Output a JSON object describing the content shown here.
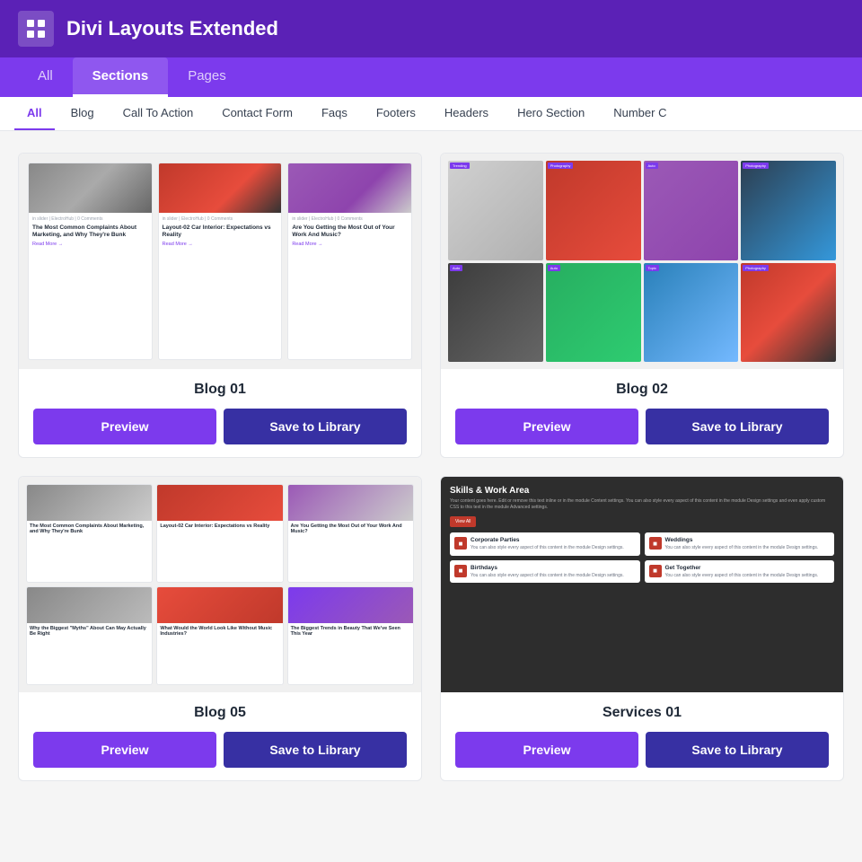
{
  "header": {
    "title": "Divi Layouts Extended",
    "icon_label": "grid-icon"
  },
  "nav": {
    "tabs": [
      {
        "id": "all",
        "label": "All",
        "active": false
      },
      {
        "id": "sections",
        "label": "Sections",
        "active": true
      },
      {
        "id": "pages",
        "label": "Pages",
        "active": false
      }
    ]
  },
  "filters": {
    "items": [
      {
        "id": "all",
        "label": "All",
        "active": true
      },
      {
        "id": "blog",
        "label": "Blog",
        "active": false
      },
      {
        "id": "cta",
        "label": "Call To Action",
        "active": false
      },
      {
        "id": "contact",
        "label": "Contact Form",
        "active": false
      },
      {
        "id": "faqs",
        "label": "Faqs",
        "active": false
      },
      {
        "id": "footers",
        "label": "Footers",
        "active": false
      },
      {
        "id": "headers",
        "label": "Headers",
        "active": false
      },
      {
        "id": "hero",
        "label": "Hero Section",
        "active": false
      },
      {
        "id": "number",
        "label": "Number C",
        "active": false
      }
    ]
  },
  "cards": [
    {
      "id": "blog01",
      "name": "Blog 01",
      "preview_label": "Preview",
      "save_label": "Save to Library",
      "type": "blog01"
    },
    {
      "id": "blog02",
      "name": "Blog 02",
      "preview_label": "Preview",
      "save_label": "Save to Library",
      "type": "blog02"
    },
    {
      "id": "blog05",
      "name": "Blog 05",
      "preview_label": "Preview",
      "save_label": "Save to Library",
      "type": "blog05"
    },
    {
      "id": "services01",
      "name": "Services 01",
      "preview_label": "Preview",
      "save_label": "Save to Library",
      "type": "services01"
    }
  ],
  "services01": {
    "title": "Skills & Work Area",
    "description": "Your content goes here. Edit or remove this text inline or in the module Content settings. You can also style every aspect of this content in the module Design settings and even apply custom CSS to this text in the module Advanced settings.",
    "button_label": "View All",
    "service_cards": [
      {
        "name": "Corporate Parties",
        "desc": "You can also style every aspect of this content in the module Design settings."
      },
      {
        "name": "Weddings",
        "desc": "You can also style every aspect of this content in the module Design settings."
      },
      {
        "name": "Birthdays",
        "desc": "You can also style every aspect of this content in the module Design settings."
      },
      {
        "name": "Get Together",
        "desc": "You can also style every aspect of this content in the module Design settings."
      }
    ]
  }
}
